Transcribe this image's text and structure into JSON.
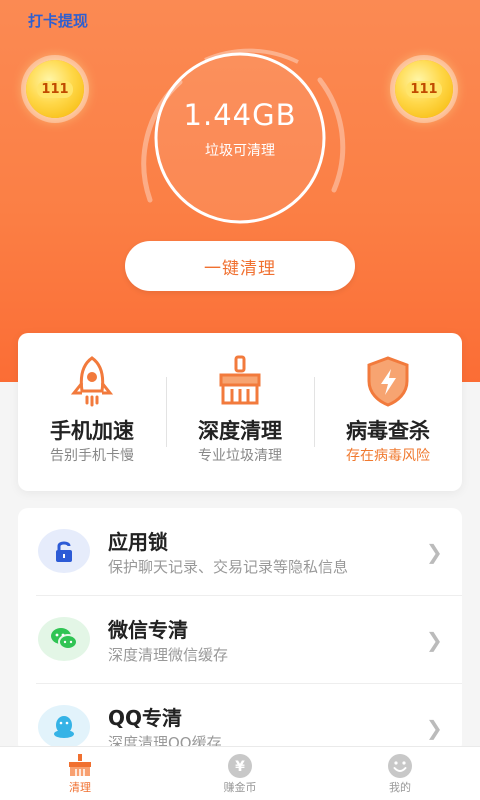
{
  "header": {
    "checkin_label": "打卡提现"
  },
  "coins": {
    "left_value": "111",
    "right_value": "111"
  },
  "gauge": {
    "value": "1.44GB",
    "label": "垃圾可清理"
  },
  "clean_button": {
    "label": "一键清理"
  },
  "features": [
    {
      "title": "手机加速",
      "subtitle": "告别手机卡慢",
      "icon": "rocket-icon"
    },
    {
      "title": "深度清理",
      "subtitle": "专业垃圾清理",
      "icon": "broom-icon"
    },
    {
      "title": "病毒查杀",
      "subtitle": "存在病毒风险",
      "icon": "shield-lightning-icon"
    }
  ],
  "list": [
    {
      "title": "应用锁",
      "subtitle": "保护聊天记录、交易记录等隐私信息",
      "icon": "lock-icon"
    },
    {
      "title": "微信专清",
      "subtitle": "深度清理微信缓存",
      "icon": "wechat-icon"
    },
    {
      "title": "QQ专清",
      "subtitle": "深度清理QQ缓存",
      "icon": "qq-icon"
    }
  ],
  "tabs": [
    {
      "label": "清理",
      "icon": "broom-icon",
      "active": true
    },
    {
      "label": "赚金币",
      "icon": "yen-coin-icon",
      "active": false
    },
    {
      "label": "我的",
      "icon": "smiley-icon",
      "active": false
    }
  ],
  "colors": {
    "accent": "#f07030",
    "hero": "#fb7f45",
    "warning_text": "#f07a30"
  }
}
